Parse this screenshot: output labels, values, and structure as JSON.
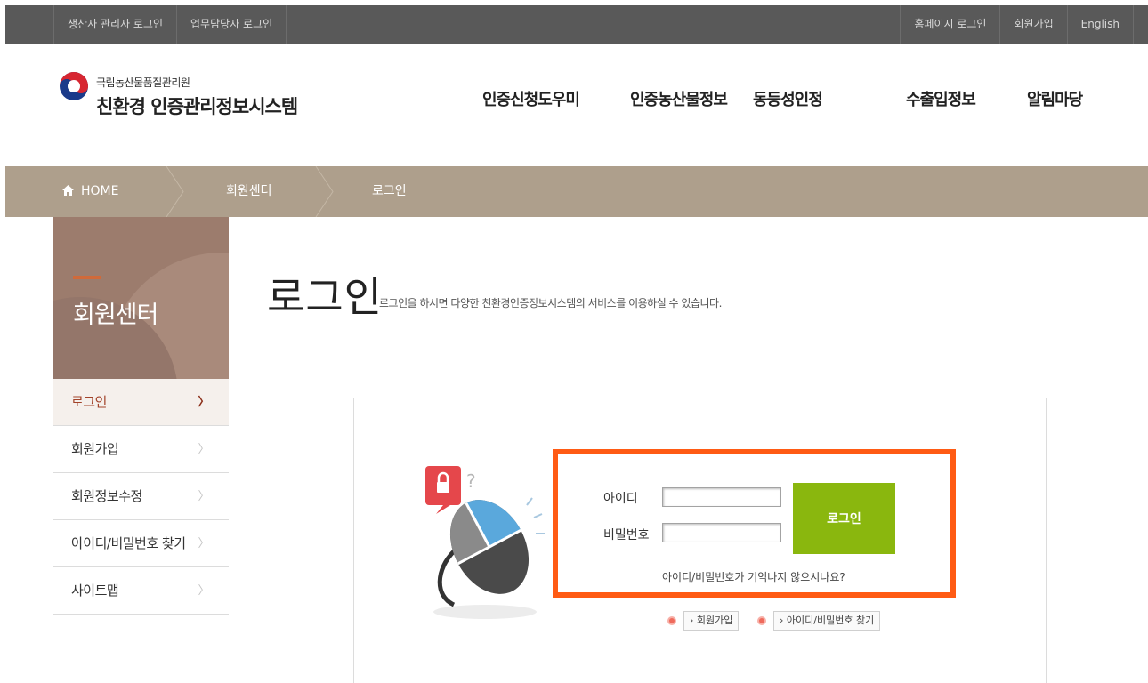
{
  "topbar": {
    "left_links": [
      "생산자 관리자 로그인",
      "업무담당자 로그인"
    ],
    "right_links": [
      "홈페이지 로그인",
      "회원가입",
      "English"
    ]
  },
  "header": {
    "org_name": "국립농산물품질관리원",
    "system_name": "친환경 인증관리정보시스템",
    "nav": [
      "인증신청도우미",
      "인증농산물정보",
      "동등성인정",
      "수출입정보",
      "알림마당"
    ]
  },
  "breadcrumb": {
    "home": "HOME",
    "level1": "회원센터",
    "level2": "로그인"
  },
  "sidebar": {
    "title": "회원센터",
    "items": [
      {
        "label": "로그인",
        "active": true
      },
      {
        "label": "회원가입",
        "active": false
      },
      {
        "label": "회원정보수정",
        "active": false
      },
      {
        "label": "아이디/비밀번호 찾기",
        "active": false
      },
      {
        "label": "사이트맵",
        "active": false
      }
    ],
    "arrow": "〉"
  },
  "main": {
    "title": "로그인",
    "description": "로그인을 하시면 다양한 친환경인증정보시스템의 서비스를 이용하실 수 있습니다."
  },
  "login": {
    "id_label": "아이디",
    "password_label": "비밀번호",
    "id_value": "",
    "password_value": "",
    "button_label": "로그인",
    "forgot_text": "아이디/비밀번호가 기억나지 않으시나요?",
    "signup_link": "회원가입",
    "find_link": "아이디/비밀번호 찾기"
  },
  "colors": {
    "topbar": "#595959",
    "breadcrumb": "#ae9f8c",
    "sidebar_header": "#9c7c6d",
    "login_button": "#8ab70e",
    "highlight_border": "#ff5b14"
  }
}
